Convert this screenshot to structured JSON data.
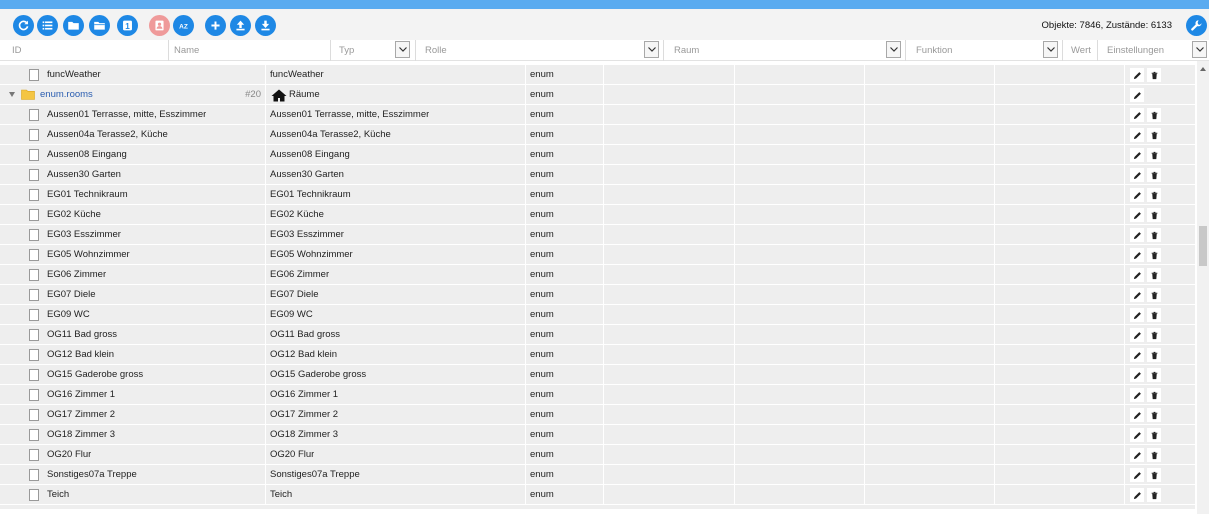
{
  "toolbar": {
    "buttons": [
      {
        "name": "refresh-button",
        "icon": "refresh-icon"
      },
      {
        "name": "list-view-button",
        "icon": "list-icon"
      },
      {
        "name": "folder-button",
        "icon": "folder-icon"
      },
      {
        "name": "folder-open-button",
        "icon": "folder-open-icon"
      },
      {
        "name": "one-button",
        "icon": "one-icon",
        "label": "1"
      },
      {
        "name": "user-button",
        "icon": "user-icon"
      },
      {
        "name": "sort-az-button",
        "icon": "sort-az-icon",
        "label": "AZ"
      },
      {
        "name": "add-button",
        "icon": "plus-icon"
      },
      {
        "name": "upload-button",
        "icon": "upload-icon"
      },
      {
        "name": "download-button",
        "icon": "download-icon"
      }
    ],
    "stats": "Objekte: 7846, Zustände: 6133"
  },
  "filters": {
    "id_placeholder": "ID",
    "name_placeholder": "Name",
    "typ": "Typ",
    "rolle": "Rolle",
    "raum": "Raum",
    "funktion": "Funktion",
    "wert": "Wert",
    "einstellungen": "Einstellungen"
  },
  "rows": [
    {
      "name": "funcWeather",
      "tname": "funcWeather",
      "typ": "enum",
      "kind": "item",
      "actions": [
        "edit",
        "delete"
      ]
    },
    {
      "name": "enum.rooms",
      "tname": "Räume",
      "typ": "enum",
      "kind": "folder",
      "id_badge": "#20",
      "actions": [
        "edit"
      ]
    },
    {
      "name": "Aussen01 Terrasse, mitte, Esszimmer",
      "tname": "Aussen01 Terrasse, mitte, Esszimmer",
      "typ": "enum",
      "kind": "item",
      "actions": [
        "edit",
        "delete"
      ]
    },
    {
      "name": "Aussen04a Terasse2, Küche",
      "tname": "Aussen04a Terasse2, Küche",
      "typ": "enum",
      "kind": "item",
      "actions": [
        "edit",
        "delete"
      ]
    },
    {
      "name": "Aussen08 Eingang",
      "tname": "Aussen08 Eingang",
      "typ": "enum",
      "kind": "item",
      "actions": [
        "edit",
        "delete"
      ]
    },
    {
      "name": "Aussen30 Garten",
      "tname": "Aussen30 Garten",
      "typ": "enum",
      "kind": "item",
      "actions": [
        "edit",
        "delete"
      ]
    },
    {
      "name": "EG01 Technikraum",
      "tname": "EG01 Technikraum",
      "typ": "enum",
      "kind": "item",
      "actions": [
        "edit",
        "delete"
      ]
    },
    {
      "name": "EG02 Küche",
      "tname": "EG02 Küche",
      "typ": "enum",
      "kind": "item",
      "actions": [
        "edit",
        "delete"
      ]
    },
    {
      "name": "EG03 Esszimmer",
      "tname": "EG03 Esszimmer",
      "typ": "enum",
      "kind": "item",
      "actions": [
        "edit",
        "delete"
      ]
    },
    {
      "name": "EG05 Wohnzimmer",
      "tname": "EG05 Wohnzimmer",
      "typ": "enum",
      "kind": "item",
      "actions": [
        "edit",
        "delete"
      ]
    },
    {
      "name": "EG06 Zimmer",
      "tname": "EG06 Zimmer",
      "typ": "enum",
      "kind": "item",
      "actions": [
        "edit",
        "delete"
      ]
    },
    {
      "name": "EG07 Diele",
      "tname": "EG07 Diele",
      "typ": "enum",
      "kind": "item",
      "actions": [
        "edit",
        "delete"
      ]
    },
    {
      "name": "EG09 WC",
      "tname": "EG09 WC",
      "typ": "enum",
      "kind": "item",
      "actions": [
        "edit",
        "delete"
      ]
    },
    {
      "name": "OG11 Bad gross",
      "tname": "OG11 Bad gross",
      "typ": "enum",
      "kind": "item",
      "actions": [
        "edit",
        "delete"
      ]
    },
    {
      "name": "OG12 Bad klein",
      "tname": "OG12 Bad klein",
      "typ": "enum",
      "kind": "item",
      "actions": [
        "edit",
        "delete"
      ]
    },
    {
      "name": "OG15 Gaderobe gross",
      "tname": "OG15 Gaderobe gross",
      "typ": "enum",
      "kind": "item",
      "actions": [
        "edit",
        "delete"
      ]
    },
    {
      "name": "OG16 Zimmer 1",
      "tname": "OG16 Zimmer 1",
      "typ": "enum",
      "kind": "item",
      "actions": [
        "edit",
        "delete"
      ]
    },
    {
      "name": "OG17 Zimmer 2",
      "tname": "OG17 Zimmer 2",
      "typ": "enum",
      "kind": "item",
      "actions": [
        "edit",
        "delete"
      ]
    },
    {
      "name": "OG18 Zimmer 3",
      "tname": "OG18 Zimmer 3",
      "typ": "enum",
      "kind": "item",
      "actions": [
        "edit",
        "delete"
      ]
    },
    {
      "name": "OG20 Flur",
      "tname": "OG20 Flur",
      "typ": "enum",
      "kind": "item",
      "actions": [
        "edit",
        "delete"
      ]
    },
    {
      "name": "Sonstiges07a Treppe",
      "tname": "Sonstiges07a Treppe",
      "typ": "enum",
      "kind": "item",
      "actions": [
        "edit",
        "delete"
      ]
    },
    {
      "name": "Teich",
      "tname": "Teich",
      "typ": "enum",
      "kind": "item",
      "actions": [
        "edit",
        "delete"
      ]
    }
  ],
  "colors": {
    "accent": "#1e88e5",
    "topbar": "#5aabf0",
    "row_bg": "#eeeeee",
    "folder_text": "#2a5db0",
    "dim_button": "#ef9a9a"
  }
}
